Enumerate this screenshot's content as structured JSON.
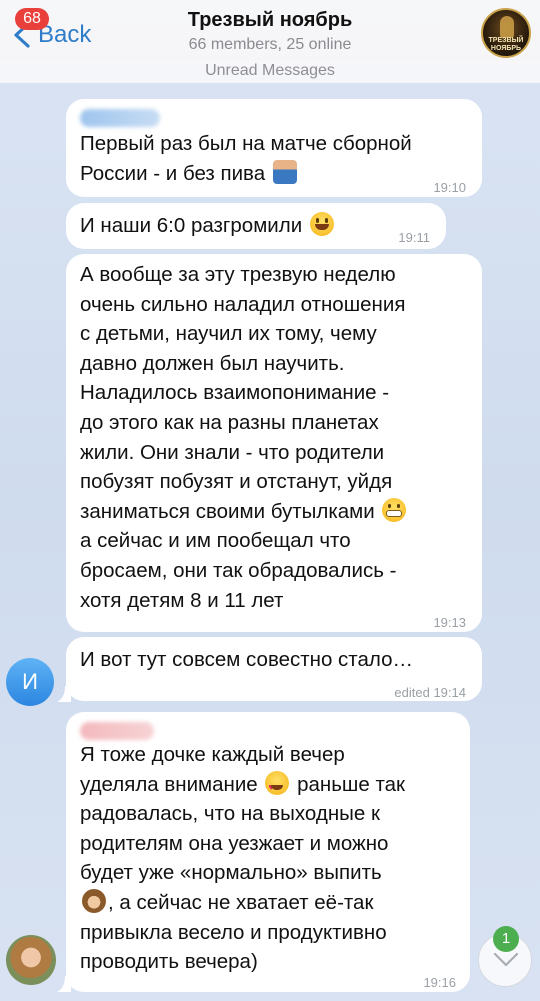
{
  "header": {
    "back_label": "Back",
    "unread_badge": "68",
    "title": "Трезвый ноябрь",
    "subtitle": "66 members, 25 online",
    "avatar_caption": "ТРЕЗВЫЙ НОЯБРЬ"
  },
  "unread_divider": "Unread Messages",
  "messages": [
    {
      "lines": [
        "Первый раз был на матче сборной",
        "России - и без пива"
      ],
      "emoji": "person-shrugging-emoji",
      "time": "19:10"
    },
    {
      "lines": [
        "И наши 6:0 разгромили"
      ],
      "emoji": "grinning-face-emoji",
      "time": "19:11"
    },
    {
      "lines": [
        "А вообще за эту трезвую неделю",
        "очень сильно наладил отношения",
        "с детьми, научил их тому, чему",
        "давно должен был научить.",
        "Наладилось взаимопонимание -",
        "до этого как на разны планетах",
        "жили. Они знали - что родители",
        "побузят побузят и отстанут, уйдя",
        "заниматься своими бутылками",
        "а сейчас и им пообещал что",
        "бросаем, они так обрадовались -",
        "хотя детям 8 и 11 лет"
      ],
      "emoji": "grimacing-face-emoji",
      "time": "19:13"
    },
    {
      "lines": [
        "И вот тут совсем совестно стало…"
      ],
      "time": "edited 19:14",
      "sender_avatar_letter": "И"
    },
    {
      "lines": [
        "Я тоже дочке каждый вечер",
        "уделяла внимание",
        "раньше так",
        "радовалась, что на выходные к",
        "родителям она уезжает и можно",
        "будет уже «нормально» выпить",
        ", а сейчас не хватает её-так",
        "привыкла весело и продуктивно",
        "проводить вечера)"
      ],
      "emoji": [
        "heart-eyes-emoji",
        "see-no-evil-monkey-emoji"
      ],
      "time": "19:16"
    }
  ],
  "scroll_down": {
    "badge": "1",
    "icon": "chevron-down-icon"
  },
  "colors": {
    "accent": "#2f7dc8",
    "badge_red": "#e9403b",
    "badge_green": "#4cae4f",
    "bubble": "#ffffff"
  }
}
